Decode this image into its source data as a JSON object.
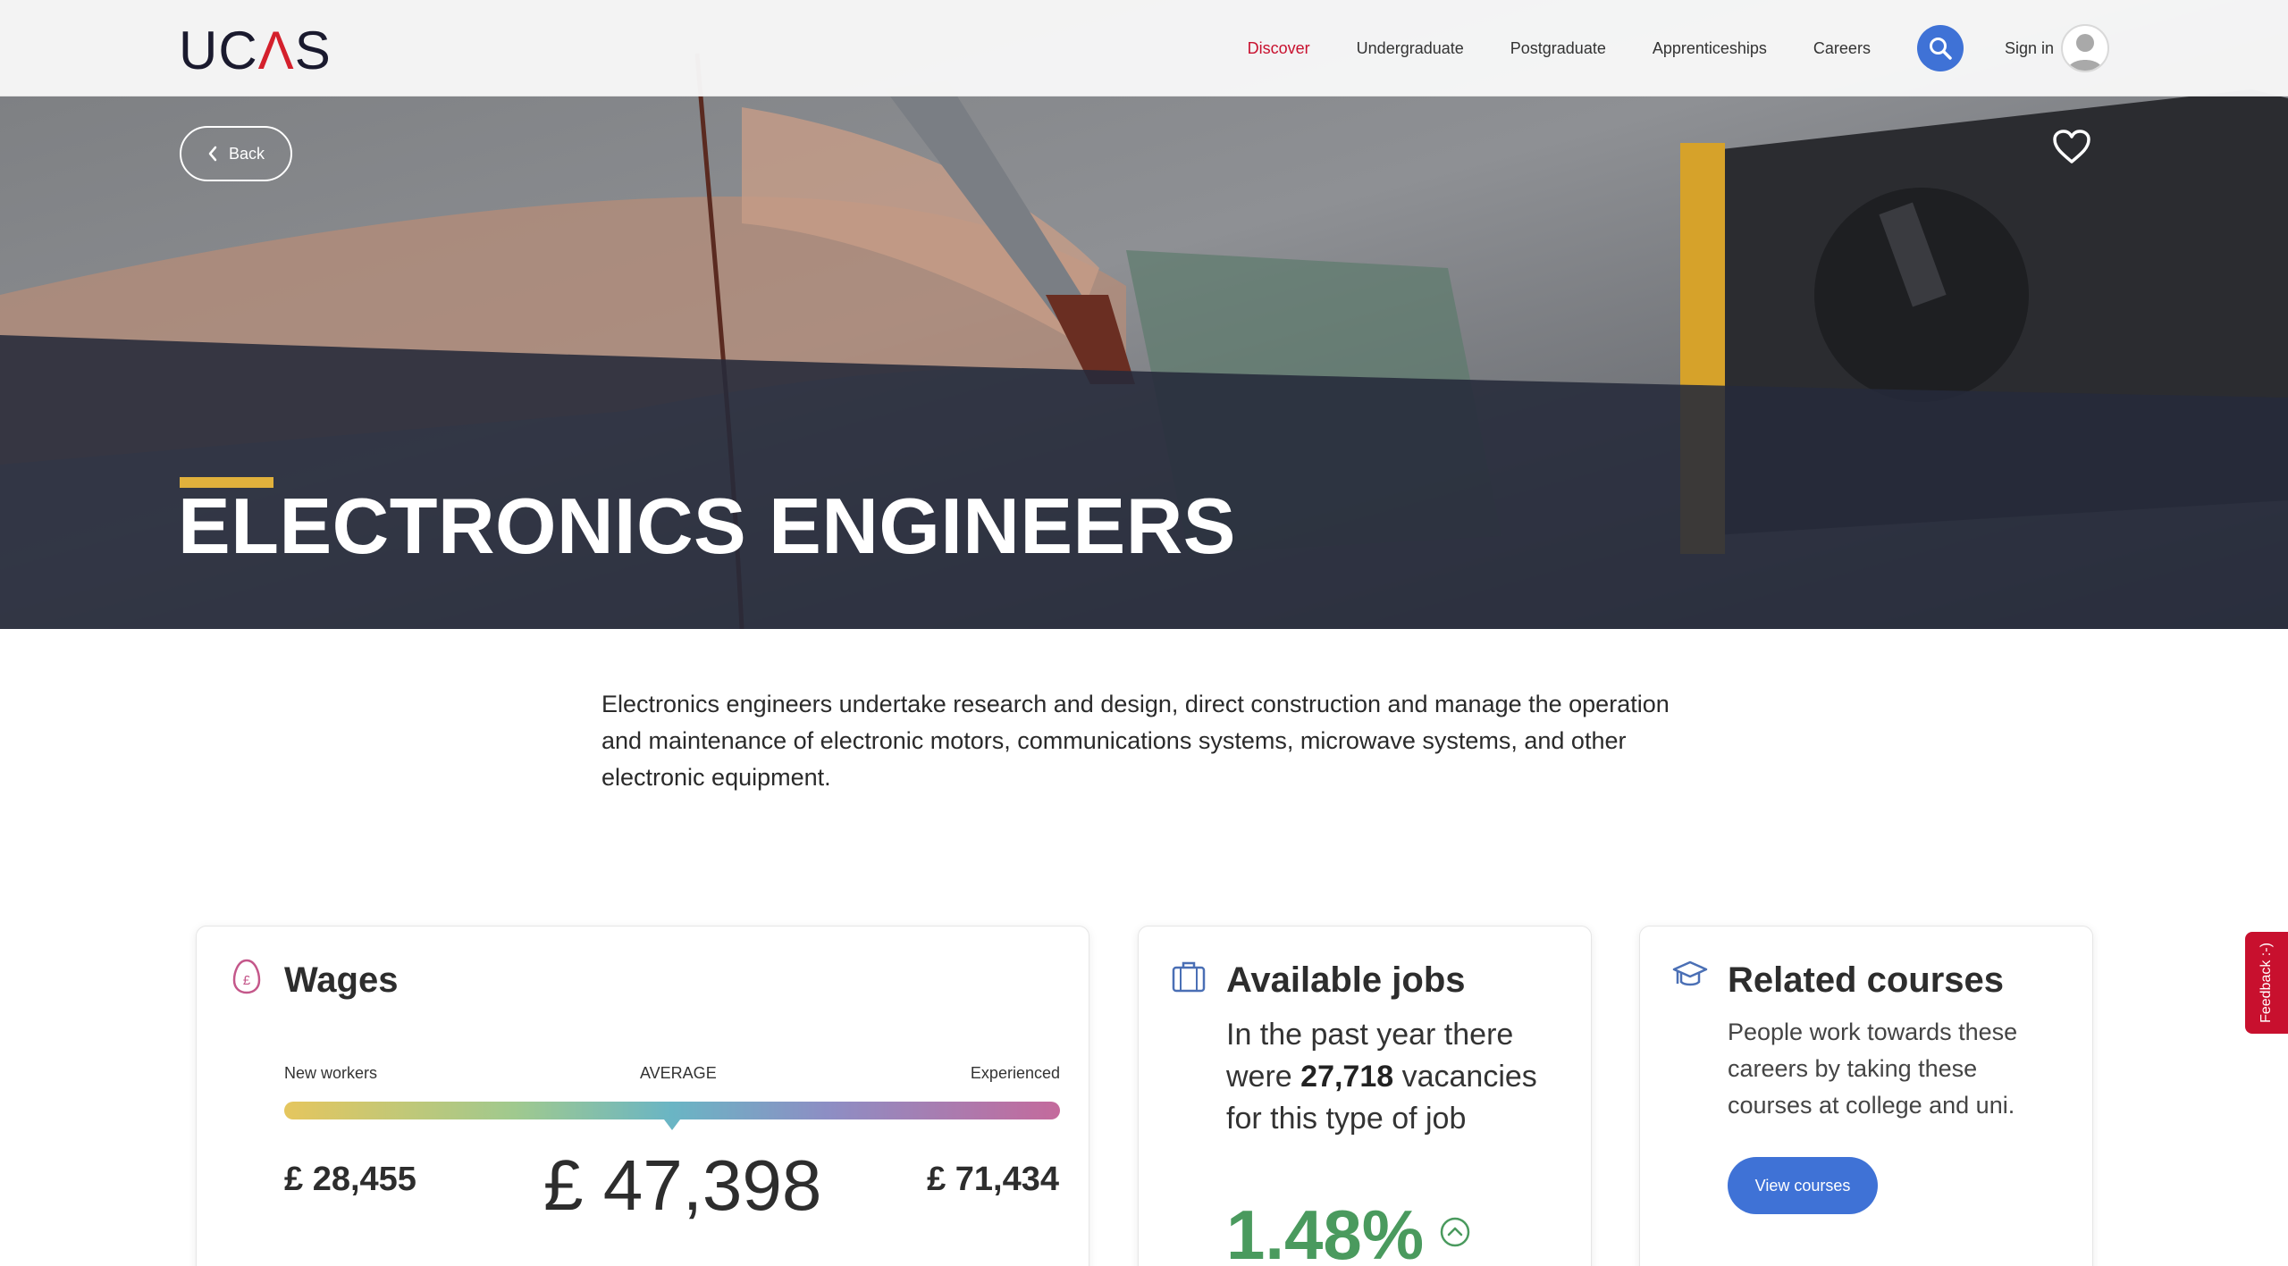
{
  "header": {
    "logo": "UC",
    "logo_a": "Λ",
    "logo_s": "S",
    "nav": [
      {
        "label": "Discover",
        "active": true
      },
      {
        "label": "Undergraduate",
        "active": false
      },
      {
        "label": "Postgraduate",
        "active": false
      },
      {
        "label": "Apprenticeships",
        "active": false
      },
      {
        "label": "Careers",
        "active": false
      }
    ],
    "search_icon": "search-icon",
    "sign_in_label": "Sign in",
    "avatar_icon": "user-avatar-icon"
  },
  "hero": {
    "back_label": "Back",
    "back_icon": "chevron-left-icon",
    "favourite_icon": "heart-icon",
    "title": "ELECTRONICS ENGINEERS",
    "accent_color": "#e1b13c"
  },
  "description": "Electronics engineers undertake research and design, direct construction and manage the operation and maintenance of electronic motors, communications systems, microwave systems, and other electronic equipment.",
  "wages": {
    "title": "Wages",
    "icon": "pound-coin-icon",
    "label_new": "New workers",
    "label_avg": "AVERAGE",
    "label_exp": "Experienced",
    "low": "£ 28,455",
    "average": "£ 47,398",
    "high": "£ 71,434"
  },
  "jobs": {
    "title": "Available jobs",
    "icon": "briefcase-icon",
    "text_prefix": "In the past year there were",
    "vacancies": "27,718",
    "text_suffix": "vacancies for this type of job",
    "percent": "1.48%",
    "trend_icon": "trend-up-icon",
    "percent_color": "#4a9a5e"
  },
  "courses": {
    "title": "Related courses",
    "icon": "graduation-cap-icon",
    "text": "People work towards these careers by taking these courses at college and uni.",
    "button_label": "View courses"
  },
  "feedback": {
    "label": "Feedback :-)"
  },
  "colors": {
    "brand_red": "#c8102e",
    "brand_blue": "#3f72d6",
    "hero_overlay": "#262a3a"
  }
}
